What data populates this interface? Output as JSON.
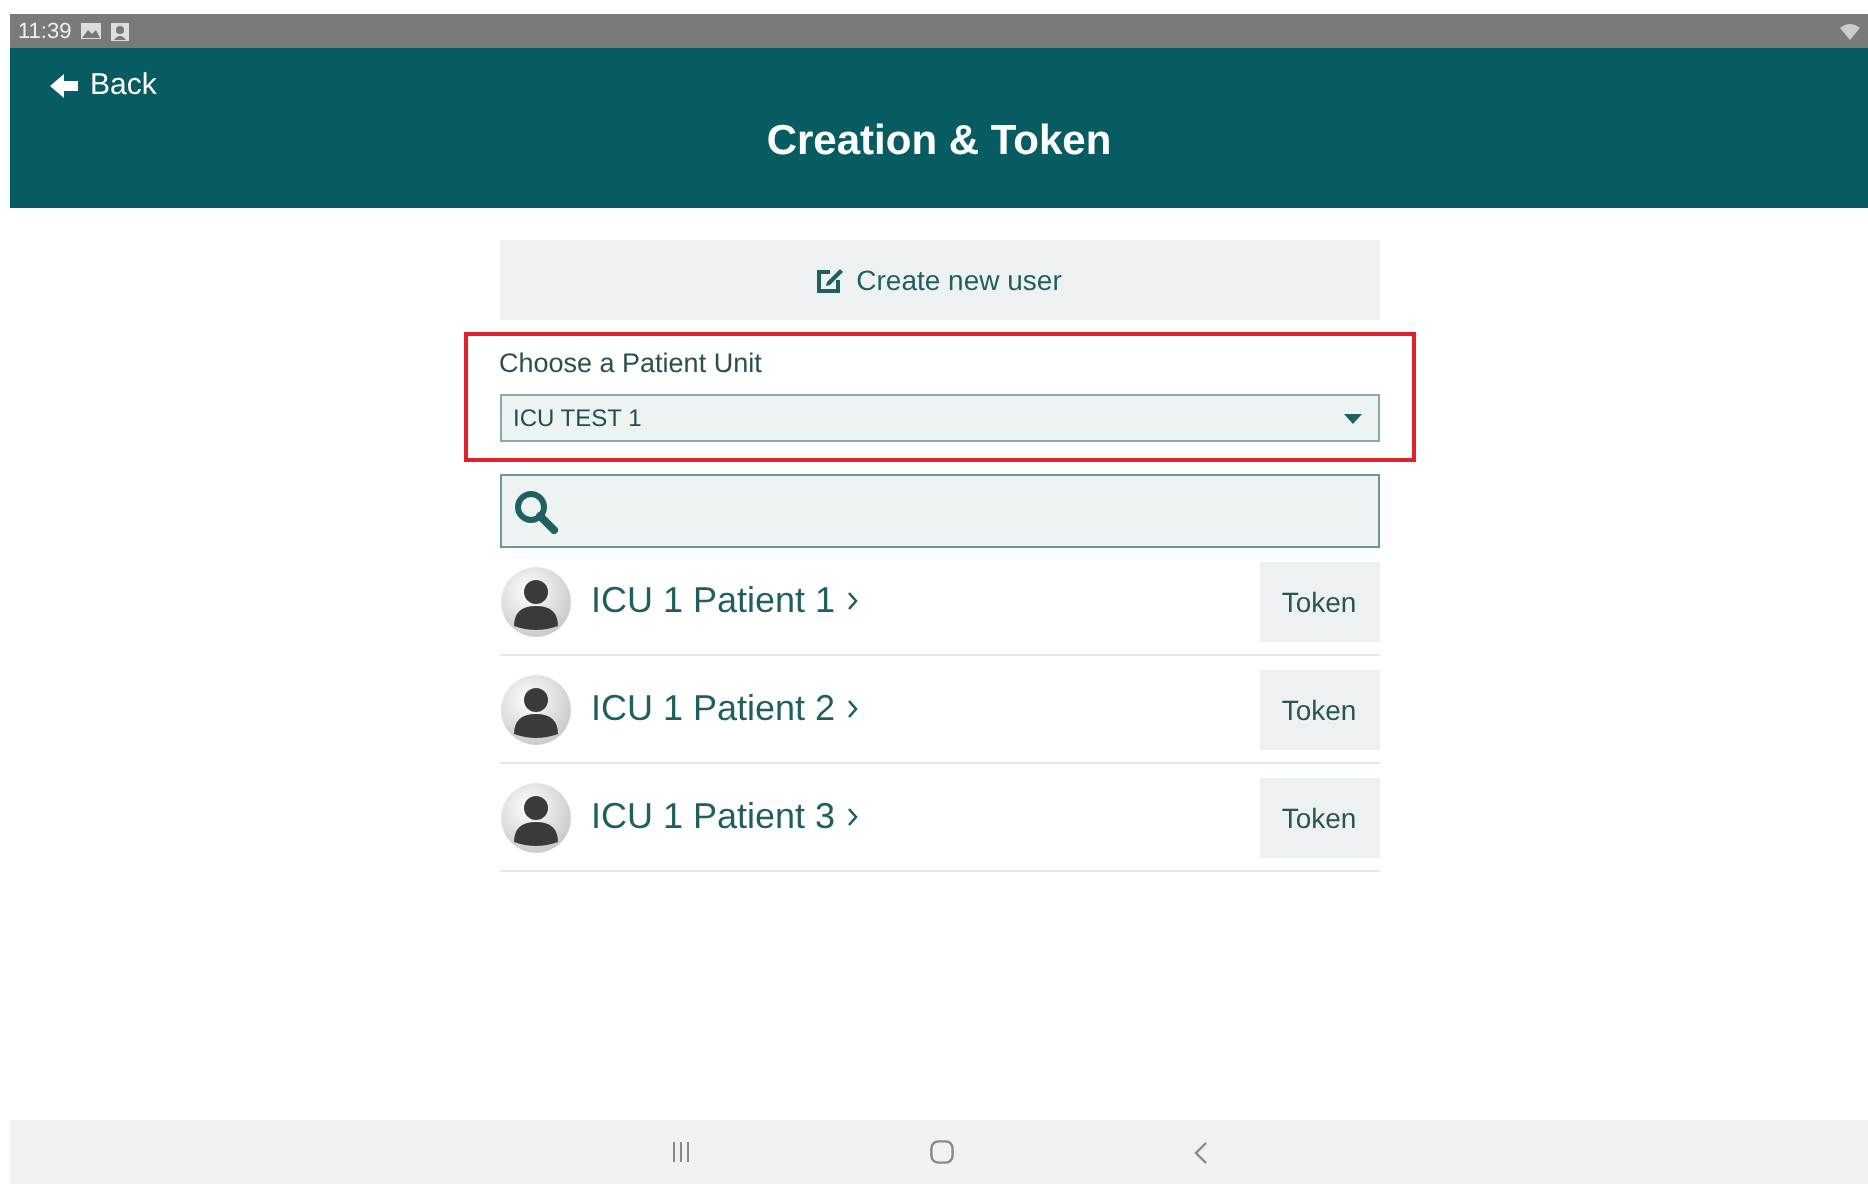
{
  "status_bar": {
    "time": "11:39"
  },
  "header": {
    "back": "Back",
    "title": "Creation & Token"
  },
  "create_button": {
    "label": "Create new user"
  },
  "unit_select": {
    "label": "Choose a Patient Unit",
    "value": "ICU TEST 1",
    "highlighted": true
  },
  "patients": [
    {
      "name": "ICU 1 Patient 1",
      "action": "Token"
    },
    {
      "name": "ICU 1 Patient 2",
      "action": "Token"
    },
    {
      "name": "ICU 1 Patient 3",
      "action": "Token"
    }
  ]
}
